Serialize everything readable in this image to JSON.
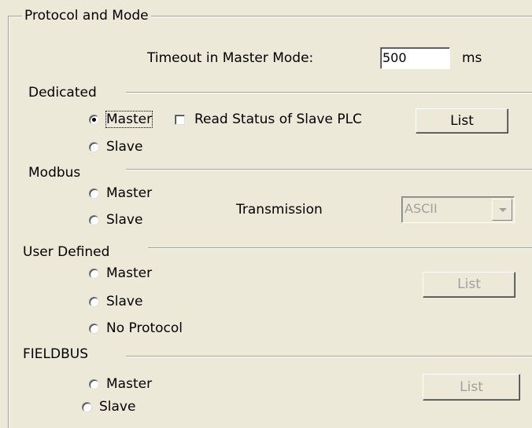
{
  "group": {
    "title": "Protocol and Mode"
  },
  "timeout": {
    "label": "Timeout in Master Mode:",
    "value": "500",
    "unit": "ms"
  },
  "dedicated": {
    "title": "Dedicated",
    "master_label": "Master",
    "slave_label": "Slave",
    "read_status_label": "Read Status of Slave PLC",
    "list_label": "List"
  },
  "modbus": {
    "title": "Modbus",
    "master_label": "Master",
    "slave_label": "Slave",
    "transmission_label": "Transmission",
    "transmission_value": "ASCII"
  },
  "user_defined": {
    "title": "User Defined",
    "master_label": "Master",
    "slave_label": "Slave",
    "no_protocol_label": "No Protocol",
    "list_label": "List"
  },
  "fieldbus": {
    "title": "FIELDBUS",
    "master_label": "Master",
    "slave_label": "Slave",
    "list_label": "List"
  }
}
